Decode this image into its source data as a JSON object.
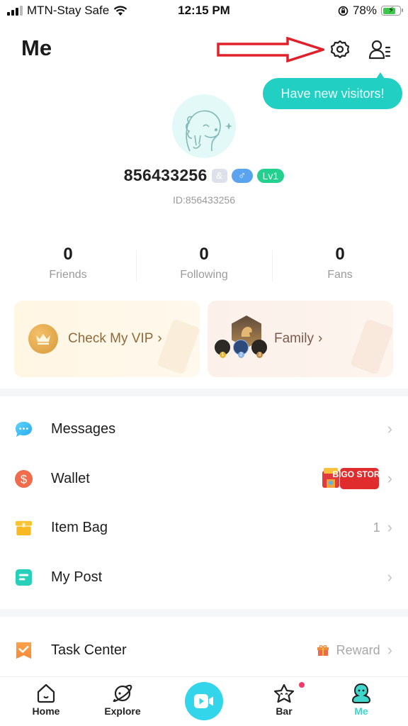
{
  "status_bar": {
    "carrier": "MTN-Stay Safe",
    "time": "12:15 PM",
    "battery_percent": "78%",
    "battery_level": 0.78,
    "icons": [
      "signal-icon",
      "wifi-icon",
      "orientation-lock-icon",
      "battery-charging-icon"
    ]
  },
  "header": {
    "title": "Me",
    "settings_icon": "gear-icon",
    "visitors_icon": "visitors-icon",
    "tooltip": "Have new visitors!"
  },
  "profile": {
    "username": "856433256",
    "id_badge_icon": "id-badge-icon",
    "gender_symbol": "♂",
    "level": "Lv1",
    "user_id": "ID:856433256"
  },
  "stats": [
    {
      "value": "0",
      "label": "Friends"
    },
    {
      "value": "0",
      "label": "Following"
    },
    {
      "value": "0",
      "label": "Fans"
    }
  ],
  "cards": {
    "vip": {
      "label": "Check My VIP",
      "chevron": "›"
    },
    "family": {
      "label": "Family",
      "chevron": "›",
      "medals": [
        "1",
        "2",
        "3"
      ]
    }
  },
  "menu": [
    {
      "label": "Messages",
      "icon": "messages-icon",
      "right": ""
    },
    {
      "label": "Wallet",
      "icon": "wallet-icon",
      "right": "",
      "promo": "BIGO STORE"
    },
    {
      "label": "Item Bag",
      "icon": "item-bag-icon",
      "right": "1"
    },
    {
      "label": "My Post",
      "icon": "my-post-icon",
      "right": ""
    },
    {
      "label": "Task Center",
      "icon": "task-center-icon",
      "right": "Reward"
    }
  ],
  "chevron": "›",
  "tabbar": {
    "tabs": [
      {
        "label": "Home",
        "icon": "home-icon"
      },
      {
        "label": "Explore",
        "icon": "explore-planet-icon"
      },
      {
        "label": "",
        "icon": "go-live-icon"
      },
      {
        "label": "Bar",
        "icon": "bar-star-icon"
      },
      {
        "label": "Me",
        "icon": "me-icon",
        "active": true
      }
    ]
  },
  "colors": {
    "accent_teal": "#21d0c3",
    "live_cyan": "#33d5ea",
    "level_green": "#23d08e",
    "gender_blue": "#5aa3ee",
    "vip_gold": "#8f6a3a",
    "notification_red": "#ef3d6a"
  }
}
